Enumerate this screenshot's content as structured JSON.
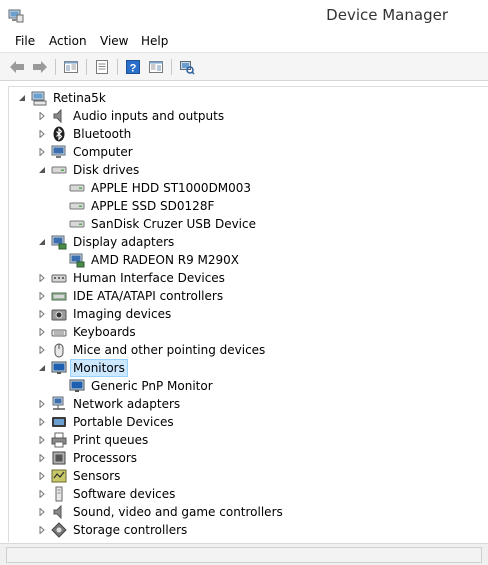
{
  "window": {
    "title": "Device Manager"
  },
  "menu": {
    "file": "File",
    "action": "Action",
    "view": "View",
    "help": "Help"
  },
  "toolbar": {
    "buttons": [
      "back-icon",
      "forward-icon",
      "console-tree-icon",
      "properties-icon",
      "help-icon",
      "show-hide-icon",
      "scan-hardware-icon"
    ]
  },
  "tree": {
    "root": "Retina5k",
    "categories": [
      {
        "label": "Audio inputs and outputs",
        "icon": "speaker-icon",
        "expanded": false
      },
      {
        "label": "Bluetooth",
        "icon": "bluetooth-icon",
        "expanded": false
      },
      {
        "label": "Computer",
        "icon": "computer-icon",
        "expanded": false
      },
      {
        "label": "Disk drives",
        "icon": "disk-drive-icon",
        "expanded": true,
        "children": [
          "APPLE HDD ST1000DM003",
          "APPLE SSD SD0128F",
          "SanDisk Cruzer USB Device"
        ]
      },
      {
        "label": "Display adapters",
        "icon": "display-adapter-icon",
        "expanded": true,
        "children": [
          "AMD RADEON R9 M290X"
        ]
      },
      {
        "label": "Human Interface Devices",
        "icon": "hid-icon",
        "expanded": false
      },
      {
        "label": "IDE ATA/ATAPI controllers",
        "icon": "ide-controller-icon",
        "expanded": false
      },
      {
        "label": "Imaging devices",
        "icon": "camera-icon",
        "expanded": false
      },
      {
        "label": "Keyboards",
        "icon": "keyboard-icon",
        "expanded": false
      },
      {
        "label": "Mice and other pointing devices",
        "icon": "mouse-icon",
        "expanded": false
      },
      {
        "label": "Monitors",
        "icon": "monitor-icon",
        "expanded": true,
        "selected": true,
        "children": [
          "Generic PnP Monitor"
        ]
      },
      {
        "label": "Network adapters",
        "icon": "network-adapter-icon",
        "expanded": false
      },
      {
        "label": "Portable Devices",
        "icon": "portable-device-icon",
        "expanded": false
      },
      {
        "label": "Print queues",
        "icon": "printer-icon",
        "expanded": false
      },
      {
        "label": "Processors",
        "icon": "processor-icon",
        "expanded": false
      },
      {
        "label": "Sensors",
        "icon": "sensor-icon",
        "expanded": false
      },
      {
        "label": "Software devices",
        "icon": "software-device-icon",
        "expanded": false
      },
      {
        "label": "Sound, video and game controllers",
        "icon": "sound-controller-icon",
        "expanded": false
      },
      {
        "label": "Storage controllers",
        "icon": "storage-controller-icon",
        "expanded": false
      }
    ]
  },
  "colors": {
    "selection": "#cce8ff",
    "toolbar_bg": "#f5f5f5",
    "expander": "#555555"
  }
}
